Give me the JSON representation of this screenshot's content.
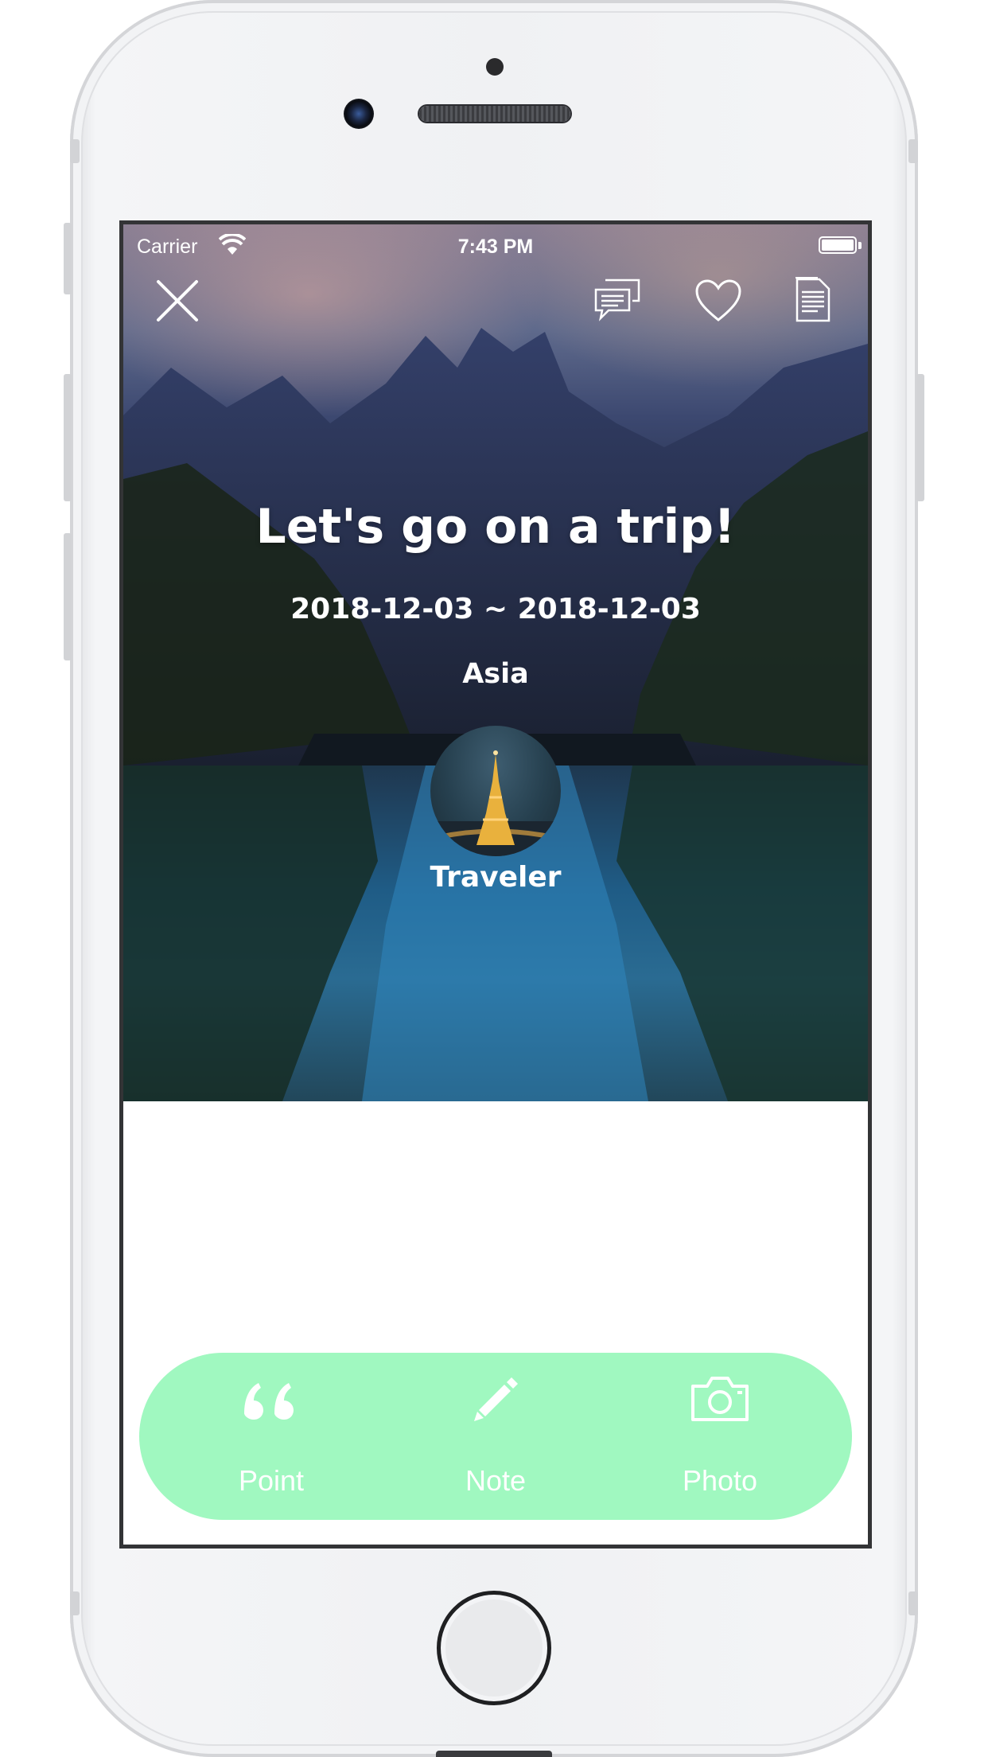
{
  "status_bar": {
    "carrier": "Carrier",
    "time": "7:43 PM"
  },
  "header": {
    "close_icon": "close-icon",
    "comments_icon": "chat-bubbles-icon",
    "like_icon": "heart-icon",
    "doc_icon": "document-icon"
  },
  "trip": {
    "title": "Let's go on a trip!",
    "dates": "2018-12-03 ~ 2018-12-03",
    "region": "Asia",
    "author": "Traveler"
  },
  "actions": [
    {
      "label": "Point",
      "icon": "quote-icon"
    },
    {
      "label": "Note",
      "icon": "pencil-icon"
    },
    {
      "label": "Photo",
      "icon": "camera-icon"
    }
  ],
  "colors": {
    "action_bar": "#a0f8c0",
    "text_light": "#ffffff"
  }
}
